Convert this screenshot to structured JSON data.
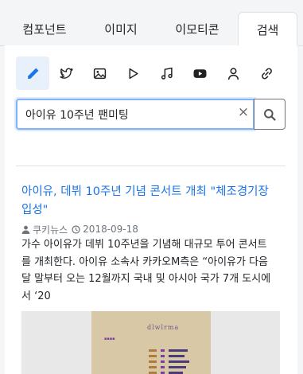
{
  "tabs": [
    "컴포넌트",
    "이미지",
    "이모티콘",
    "검색"
  ],
  "icon_buttons": [
    "pencil-icon",
    "twitter-icon",
    "image-icon",
    "play-icon",
    "music-icon",
    "youtube-icon",
    "user-icon",
    "link-icon"
  ],
  "search": {
    "value": "아이유 10주년 팬미팅",
    "clear_label": "×"
  },
  "result": {
    "title": "아이유, 데뷔 10주년 기념 콘서트 개최 \"체조경기장 입성\"",
    "source": "쿠키뉴스",
    "date": "2018-09-18",
    "snippet": "가수 아이유가 데뷔 10주년을 기념해 대규모 투어 콘서트를 개최한다. 아이유 소속사 카카오M측은 “아이유가 다음달 말부터 오는 12월까지 국내 및 아시아 국가 7개 도시에서 ‘20",
    "thumbnail_title": "dlwlrma"
  },
  "colors": {
    "accent": "#1a73e8",
    "active_bg": "#e7f0fb"
  }
}
